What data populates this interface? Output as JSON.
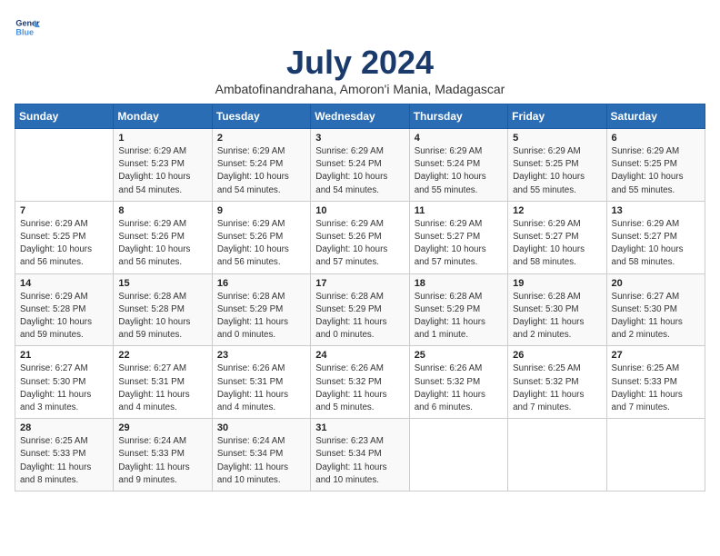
{
  "header": {
    "logo_line1": "General",
    "logo_line2": "Blue",
    "month_title": "July 2024",
    "subtitle": "Ambatofinandrahana, Amoron'i Mania, Madagascar"
  },
  "weekdays": [
    "Sunday",
    "Monday",
    "Tuesday",
    "Wednesday",
    "Thursday",
    "Friday",
    "Saturday"
  ],
  "weeks": [
    [
      {
        "day": "",
        "info": ""
      },
      {
        "day": "1",
        "info": "Sunrise: 6:29 AM\nSunset: 5:23 PM\nDaylight: 10 hours\nand 54 minutes."
      },
      {
        "day": "2",
        "info": "Sunrise: 6:29 AM\nSunset: 5:24 PM\nDaylight: 10 hours\nand 54 minutes."
      },
      {
        "day": "3",
        "info": "Sunrise: 6:29 AM\nSunset: 5:24 PM\nDaylight: 10 hours\nand 54 minutes."
      },
      {
        "day": "4",
        "info": "Sunrise: 6:29 AM\nSunset: 5:24 PM\nDaylight: 10 hours\nand 55 minutes."
      },
      {
        "day": "5",
        "info": "Sunrise: 6:29 AM\nSunset: 5:25 PM\nDaylight: 10 hours\nand 55 minutes."
      },
      {
        "day": "6",
        "info": "Sunrise: 6:29 AM\nSunset: 5:25 PM\nDaylight: 10 hours\nand 55 minutes."
      }
    ],
    [
      {
        "day": "7",
        "info": "Sunrise: 6:29 AM\nSunset: 5:25 PM\nDaylight: 10 hours\nand 56 minutes."
      },
      {
        "day": "8",
        "info": "Sunrise: 6:29 AM\nSunset: 5:26 PM\nDaylight: 10 hours\nand 56 minutes."
      },
      {
        "day": "9",
        "info": "Sunrise: 6:29 AM\nSunset: 5:26 PM\nDaylight: 10 hours\nand 56 minutes."
      },
      {
        "day": "10",
        "info": "Sunrise: 6:29 AM\nSunset: 5:26 PM\nDaylight: 10 hours\nand 57 minutes."
      },
      {
        "day": "11",
        "info": "Sunrise: 6:29 AM\nSunset: 5:27 PM\nDaylight: 10 hours\nand 57 minutes."
      },
      {
        "day": "12",
        "info": "Sunrise: 6:29 AM\nSunset: 5:27 PM\nDaylight: 10 hours\nand 58 minutes."
      },
      {
        "day": "13",
        "info": "Sunrise: 6:29 AM\nSunset: 5:27 PM\nDaylight: 10 hours\nand 58 minutes."
      }
    ],
    [
      {
        "day": "14",
        "info": "Sunrise: 6:29 AM\nSunset: 5:28 PM\nDaylight: 10 hours\nand 59 minutes."
      },
      {
        "day": "15",
        "info": "Sunrise: 6:28 AM\nSunset: 5:28 PM\nDaylight: 10 hours\nand 59 minutes."
      },
      {
        "day": "16",
        "info": "Sunrise: 6:28 AM\nSunset: 5:29 PM\nDaylight: 11 hours\nand 0 minutes."
      },
      {
        "day": "17",
        "info": "Sunrise: 6:28 AM\nSunset: 5:29 PM\nDaylight: 11 hours\nand 0 minutes."
      },
      {
        "day": "18",
        "info": "Sunrise: 6:28 AM\nSunset: 5:29 PM\nDaylight: 11 hours\nand 1 minute."
      },
      {
        "day": "19",
        "info": "Sunrise: 6:28 AM\nSunset: 5:30 PM\nDaylight: 11 hours\nand 2 minutes."
      },
      {
        "day": "20",
        "info": "Sunrise: 6:27 AM\nSunset: 5:30 PM\nDaylight: 11 hours\nand 2 minutes."
      }
    ],
    [
      {
        "day": "21",
        "info": "Sunrise: 6:27 AM\nSunset: 5:30 PM\nDaylight: 11 hours\nand 3 minutes."
      },
      {
        "day": "22",
        "info": "Sunrise: 6:27 AM\nSunset: 5:31 PM\nDaylight: 11 hours\nand 4 minutes."
      },
      {
        "day": "23",
        "info": "Sunrise: 6:26 AM\nSunset: 5:31 PM\nDaylight: 11 hours\nand 4 minutes."
      },
      {
        "day": "24",
        "info": "Sunrise: 6:26 AM\nSunset: 5:32 PM\nDaylight: 11 hours\nand 5 minutes."
      },
      {
        "day": "25",
        "info": "Sunrise: 6:26 AM\nSunset: 5:32 PM\nDaylight: 11 hours\nand 6 minutes."
      },
      {
        "day": "26",
        "info": "Sunrise: 6:25 AM\nSunset: 5:32 PM\nDaylight: 11 hours\nand 7 minutes."
      },
      {
        "day": "27",
        "info": "Sunrise: 6:25 AM\nSunset: 5:33 PM\nDaylight: 11 hours\nand 7 minutes."
      }
    ],
    [
      {
        "day": "28",
        "info": "Sunrise: 6:25 AM\nSunset: 5:33 PM\nDaylight: 11 hours\nand 8 minutes."
      },
      {
        "day": "29",
        "info": "Sunrise: 6:24 AM\nSunset: 5:33 PM\nDaylight: 11 hours\nand 9 minutes."
      },
      {
        "day": "30",
        "info": "Sunrise: 6:24 AM\nSunset: 5:34 PM\nDaylight: 11 hours\nand 10 minutes."
      },
      {
        "day": "31",
        "info": "Sunrise: 6:23 AM\nSunset: 5:34 PM\nDaylight: 11 hours\nand 10 minutes."
      },
      {
        "day": "",
        "info": ""
      },
      {
        "day": "",
        "info": ""
      },
      {
        "day": "",
        "info": ""
      }
    ]
  ]
}
